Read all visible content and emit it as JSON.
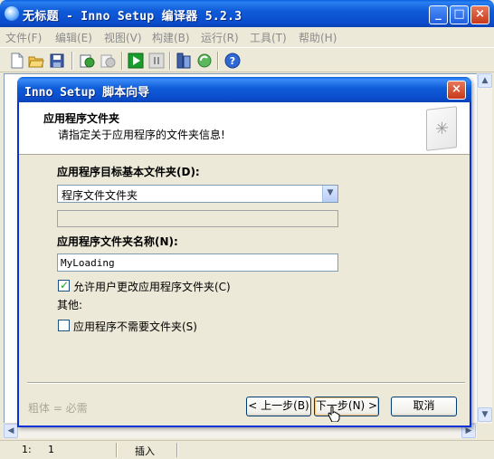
{
  "window": {
    "title": "无标题 - Inno Setup 编译器 5.2.3",
    "buttons": {
      "minimize": "_",
      "maximize": "□",
      "close": "×"
    }
  },
  "menu": {
    "items": [
      "文件(F)",
      "编辑(E)",
      "视图(V)",
      "构建(B)",
      "运行(R)",
      "工具(T)",
      "帮助(H)"
    ]
  },
  "toolbar": {
    "icons": [
      "new-file-icon",
      "open-folder-icon",
      "save-icon",
      "compile-icon",
      "stop-compile-icon",
      "run-icon",
      "pause-icon",
      "wizard-icon",
      "refresh-icon",
      "help-icon"
    ]
  },
  "statusbar": {
    "line": "1:",
    "col": "1",
    "mode": "插入"
  },
  "dialog": {
    "title": "Inno Setup 脚本向导",
    "close_label": "×",
    "header": {
      "title": "应用程序文件夹",
      "subtitle": "请指定关于应用程序的文件夹信息!"
    },
    "base_folder_label": "应用程序目标基本文件夹(D):",
    "base_folder_value": "程序文件文件夹",
    "folder_name_label": "应用程序文件夹名称(N):",
    "folder_name_value": "MyLoading",
    "allow_change_label": "允许用户更改应用程序文件夹(C)",
    "allow_change_checked": true,
    "other_label": "其他:",
    "no_folder_label": "应用程序不需要文件夹(S)",
    "no_folder_checked": false,
    "footnote": "粗体 = 必需",
    "buttons": {
      "back": "< 上一步(B)",
      "next": "下一步(N) >",
      "cancel": "取消"
    }
  }
}
